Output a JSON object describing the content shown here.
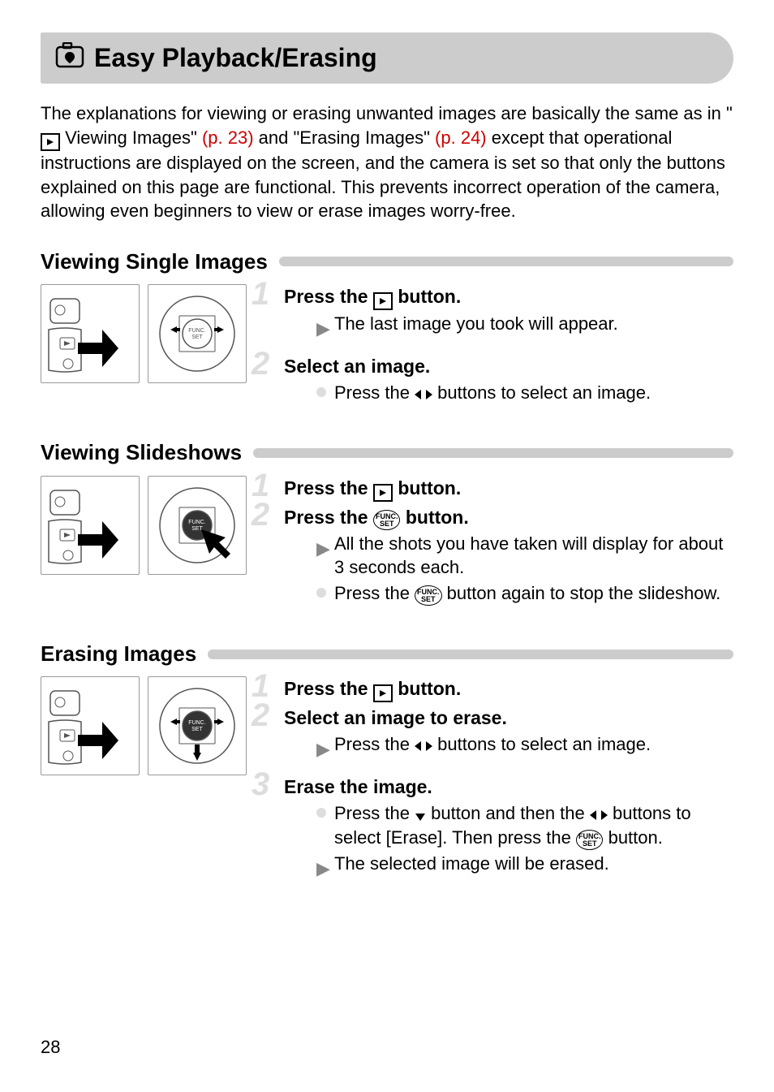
{
  "page": {
    "title": "Easy Playback/Erasing",
    "number": "28"
  },
  "intro": {
    "part1": "The explanations for viewing or erasing unwanted images are basically the same as in \"",
    "ref1_label": " Viewing Images\" ",
    "ref1_page": "(p. 23)",
    "part2": " and \"Erasing Images\" ",
    "ref2_page": "(p. 24)",
    "part3": " except that operational instructions are displayed on the screen, and the camera is set so that only the buttons explained on this page are functional. This prevents incorrect operation of the camera, allowing even beginners to view or erase images worry-free."
  },
  "sections": {
    "single": {
      "heading": "Viewing Single Images",
      "step1": {
        "title_pre": "Press the ",
        "title_post": " button.",
        "body1": "The last image you took will appear."
      },
      "step2": {
        "title": "Select an image.",
        "body1_pre": "Press the ",
        "body1_post": " buttons to select an image."
      }
    },
    "slides": {
      "heading": "Viewing Slideshows",
      "step1": {
        "title_pre": "Press the ",
        "title_post": " button."
      },
      "step2": {
        "title_pre": "Press the ",
        "title_post": " button.",
        "body1": "All the shots you have taken will display for about 3 seconds each.",
        "body2_pre": "Press the ",
        "body2_post": " button again to stop the slideshow."
      }
    },
    "erase": {
      "heading": "Erasing Images",
      "step1": {
        "title_pre": "Press the ",
        "title_post": " button."
      },
      "step2": {
        "title": "Select an image to erase.",
        "body1_pre": "Press the ",
        "body1_post": " buttons to select an image."
      },
      "step3": {
        "title": "Erase the image.",
        "body1_pre": "Press the ",
        "body1_mid": " button and then the ",
        "body1_post": " buttons to select [Erase]. Then press the ",
        "body1_end": " button.",
        "body2": "The selected image will be erased."
      }
    }
  },
  "icons": {
    "func_label": "FUNC.\nSET"
  }
}
